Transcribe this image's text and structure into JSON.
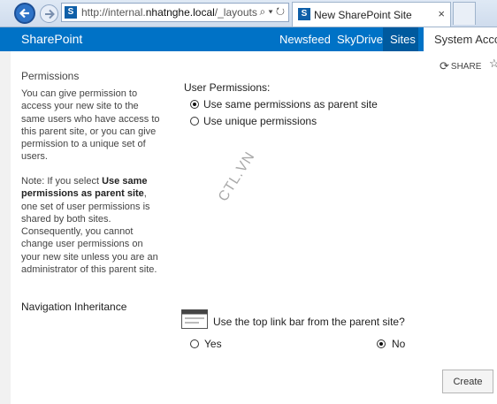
{
  "browser": {
    "url_prefix": "http://internal.",
    "url_domain": "nhatnghe.local",
    "url_path": "/_layouts",
    "url_icons": "⌕ ▾ ↻",
    "tab_title": "New SharePoint Site",
    "tab_close": "×"
  },
  "suitebar": {
    "brand": "SharePoint",
    "links": [
      "Newsfeed",
      "SkyDrive",
      "Sites"
    ],
    "account": "System Accou",
    "accent_color": "#0072c6"
  },
  "share": {
    "label": "SHARE",
    "icon": "share-icon"
  },
  "permissions": {
    "section_title": "Permissions",
    "description": "You can give permission to access your new site to the same users who have access to this parent site, or you can give permission to a unique set of users.",
    "note_prefix": "Note: If you select ",
    "note_bold": "Use same permissions as parent site",
    "note_suffix": ", one set of user permissions is shared by both sites. Consequently, you cannot change user permissions on your new site unless you are an administrator of this parent site.",
    "field_label": "User Permissions:",
    "options": [
      "Use same permissions as parent site",
      "Use unique permissions"
    ],
    "selected": "Use same permissions as parent site"
  },
  "navigation": {
    "section_title": "Navigation Inheritance",
    "question": "Use the top link bar from the parent site?",
    "yes": "Yes",
    "no": "No",
    "selected": "No"
  },
  "buttons": {
    "create": "Create"
  },
  "watermark": "CTL.VN"
}
